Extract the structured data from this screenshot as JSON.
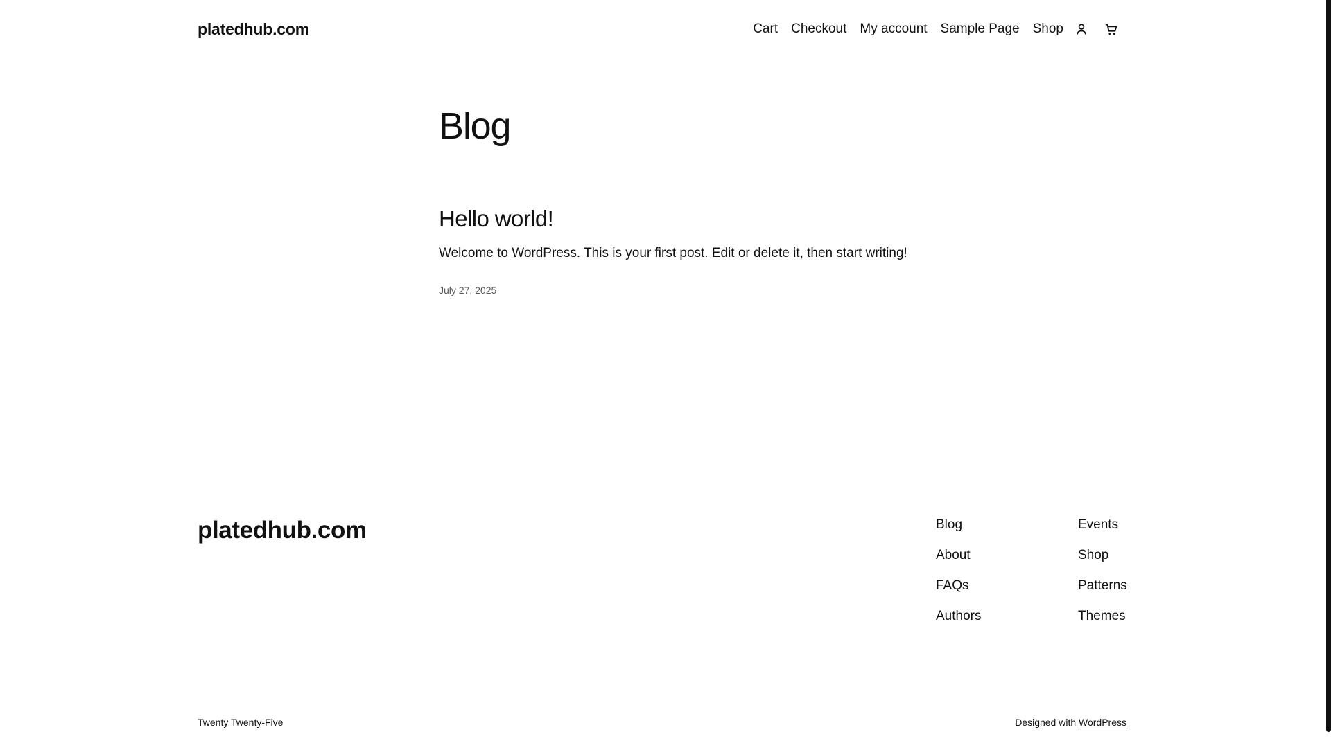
{
  "header": {
    "site_title": "platedhub.com",
    "nav": [
      {
        "label": "Cart"
      },
      {
        "label": "Checkout"
      },
      {
        "label": "My account"
      },
      {
        "label": "Sample Page"
      },
      {
        "label": "Shop"
      }
    ],
    "icons": [
      "user-icon",
      "cart-icon"
    ]
  },
  "main": {
    "page_title": "Blog",
    "posts": [
      {
        "title": "Hello world!",
        "excerpt": "Welcome to WordPress. This is your first post. Edit or delete it, then start writing!",
        "date": "July 27, 2025"
      }
    ]
  },
  "footer": {
    "site_title": "platedhub.com",
    "col1": [
      {
        "label": "Blog"
      },
      {
        "label": "About"
      },
      {
        "label": "FAQs"
      },
      {
        "label": "Authors"
      }
    ],
    "col2": [
      {
        "label": "Events"
      },
      {
        "label": "Shop"
      },
      {
        "label": "Patterns"
      },
      {
        "label": "Themes"
      }
    ],
    "credit_left": "Twenty Twenty-Five",
    "credit_right_prefix": "Designed with ",
    "credit_right_link": "WordPress"
  },
  "colors": {
    "text": "#111111",
    "background": "#ffffff",
    "muted": "#555555"
  }
}
